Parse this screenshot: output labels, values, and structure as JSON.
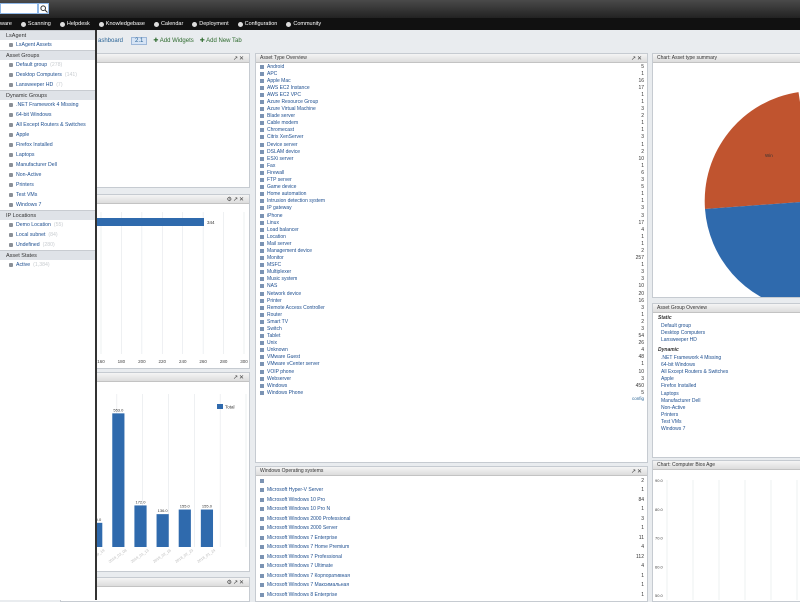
{
  "topbar": {
    "search_value": ""
  },
  "nav": {
    "items": [
      "ware",
      "Scanning",
      "Helpdesk",
      "Knowledgebase",
      "Calendar",
      "Deployment",
      "Configuration",
      "Community"
    ]
  },
  "tabbar": {
    "dashboard": "ashboard",
    "num": "2.1",
    "add_widgets": "Add Widgets",
    "add_tab": "Add New Tab"
  },
  "sidebar": {
    "sections": [
      {
        "title": "LsAgent",
        "items": [
          {
            "label": "LsAgent Assets",
            "count": ""
          }
        ]
      },
      {
        "title": "Asset Groups",
        "items": [
          {
            "label": "Default group",
            "count": "(278)"
          },
          {
            "label": "Desktop Computers",
            "count": "(141)"
          },
          {
            "label": "Lansweeper HD",
            "count": "(7)"
          }
        ]
      },
      {
        "title": "Dynamic Groups",
        "items": [
          {
            "label": ".NET Framework 4 Missing",
            "count": ""
          },
          {
            "label": "64-bit Windows",
            "count": ""
          },
          {
            "label": "All Except Routers & Switches",
            "count": ""
          },
          {
            "label": "Apple",
            "count": ""
          },
          {
            "label": "Firefox Installed",
            "count": ""
          },
          {
            "label": "Laptops",
            "count": ""
          },
          {
            "label": "Manufacturer Dell",
            "count": ""
          },
          {
            "label": "Non-Active",
            "count": ""
          },
          {
            "label": "Printers",
            "count": ""
          },
          {
            "label": "Test VMs",
            "count": ""
          },
          {
            "label": "Windows 7",
            "count": ""
          }
        ]
      },
      {
        "title": "IP Locations",
        "items": [
          {
            "label": "Demo Location",
            "count": "(55)"
          },
          {
            "label": "Local subnet",
            "count": "(84)"
          },
          {
            "label": "Undefined",
            "count": "(280)"
          }
        ]
      },
      {
        "title": "Asset States",
        "items": [
          {
            "label": "Active",
            "count": "(1,384)"
          }
        ]
      }
    ]
  },
  "asset_type_overview": {
    "title": "Asset Type Overview",
    "rows": [
      {
        "label": "Android",
        "value": "5"
      },
      {
        "label": "APC",
        "value": "1"
      },
      {
        "label": "Apple Mac",
        "value": "16"
      },
      {
        "label": "AWS EC2 Instance",
        "value": "17"
      },
      {
        "label": "AWS EC2 VPC",
        "value": "1"
      },
      {
        "label": "Azure Resource Group",
        "value": "1"
      },
      {
        "label": "Azure Virtual Machine",
        "value": "3"
      },
      {
        "label": "Blade server",
        "value": "2"
      },
      {
        "label": "Cable modem",
        "value": "1"
      },
      {
        "label": "Chromecast",
        "value": "1"
      },
      {
        "label": "Citrix XenServer",
        "value": "3"
      },
      {
        "label": "Device server",
        "value": "1"
      },
      {
        "label": "DSLAM device",
        "value": "2"
      },
      {
        "label": "ESXi server",
        "value": "10"
      },
      {
        "label": "Fax",
        "value": "1"
      },
      {
        "label": "Firewall",
        "value": "6"
      },
      {
        "label": "FTP server",
        "value": "3"
      },
      {
        "label": "Game device",
        "value": "5"
      },
      {
        "label": "Home automation",
        "value": "1"
      },
      {
        "label": "Intrusion detection system",
        "value": "1"
      },
      {
        "label": "IP gateway",
        "value": "3"
      },
      {
        "label": "iPhone",
        "value": "3"
      },
      {
        "label": "Linux",
        "value": "17"
      },
      {
        "label": "Load balancer",
        "value": "4"
      },
      {
        "label": "Location",
        "value": "1"
      },
      {
        "label": "Mail server",
        "value": "1"
      },
      {
        "label": "Management device",
        "value": "2"
      },
      {
        "label": "Monitor",
        "value": "257"
      },
      {
        "label": "MSFC",
        "value": "1"
      },
      {
        "label": "Multiplexer",
        "value": "3"
      },
      {
        "label": "Music system",
        "value": "3"
      },
      {
        "label": "NAS",
        "value": "10"
      },
      {
        "label": "Network device",
        "value": "20"
      },
      {
        "label": "Printer",
        "value": "16"
      },
      {
        "label": "Remote Access Controller",
        "value": "3"
      },
      {
        "label": "Router",
        "value": "1"
      },
      {
        "label": "Smart TV",
        "value": "2"
      },
      {
        "label": "Switch",
        "value": "3"
      },
      {
        "label": "Tablet",
        "value": "54"
      },
      {
        "label": "Unix",
        "value": "26"
      },
      {
        "label": "Unknown",
        "value": "4"
      },
      {
        "label": "VMware Guest",
        "value": "48"
      },
      {
        "label": "VMware vCenter server",
        "value": "1"
      },
      {
        "label": "VOIP phone",
        "value": "10"
      },
      {
        "label": "Webserver",
        "value": "3"
      },
      {
        "label": "Windows",
        "value": "450"
      },
      {
        "label": "Windows Phone",
        "value": "5"
      }
    ],
    "footer": "config"
  },
  "windows_os": {
    "title": "Windows Operating systems",
    "rows": [
      {
        "label": "",
        "value": "2"
      },
      {
        "label": "Microsoft Hyper-V Server",
        "value": "1"
      },
      {
        "label": "Microsoft Windows 10 Pro",
        "value": "84"
      },
      {
        "label": "Microsoft Windows 10 Pro N",
        "value": "1"
      },
      {
        "label": "Microsoft Windows 2000 Professional",
        "value": "3"
      },
      {
        "label": "Microsoft Windows 2000 Server",
        "value": "1"
      },
      {
        "label": "Microsoft Windows 7 Enterprise",
        "value": "11"
      },
      {
        "label": "Microsoft Windows 7 Home Premium",
        "value": "4"
      },
      {
        "label": "Microsoft Windows 7 Professional",
        "value": "112"
      },
      {
        "label": "Microsoft Windows 7 Ultimate",
        "value": "4"
      },
      {
        "label": "Microsoft Windows 7 Корпоративная",
        "value": "1"
      },
      {
        "label": "Microsoft Windows 7 Максимальная",
        "value": "1"
      },
      {
        "label": "Microsoft Windows 8 Enterprise",
        "value": "1"
      }
    ]
  },
  "asset_group_overview": {
    "title": "Asset Group Overview",
    "static_label": "Static",
    "static": [
      "Default group",
      "Desktop Computers",
      "Lansweeper HD"
    ],
    "dynamic_label": "Dynamic",
    "dynamic": [
      ".NET Framework 4 Missing",
      "64-bit Windows",
      "All Except Routers & Switches",
      "Apple",
      "Firefox Installed",
      "Laptops",
      "Manufacturer Dell",
      "Non-Active",
      "Printers",
      "Test VMs",
      "Windows 7"
    ]
  },
  "pie_panel": {
    "title": "Chart: Asset type summary",
    "slice_label": "Win"
  },
  "bios_panel": {
    "title": "Chart: Computer Bios Age"
  },
  "colors": {
    "pie_blue": "#2f6aad",
    "pie_red": "#c0542f",
    "bar_blue": "#2f6aad",
    "link": "#1d4e8f"
  },
  "chart_data": [
    {
      "type": "bar",
      "orientation": "horizontal",
      "values": [
        344
      ],
      "xlim": [
        0,
        300
      ],
      "tick_labels": [
        "160",
        "180",
        "200",
        "220",
        "240",
        "260",
        "280",
        "300"
      ],
      "data_labels": [
        "344"
      ]
    },
    {
      "type": "bar",
      "categories": [
        "2018_09_13",
        "2018_09_18",
        "2018_02_08",
        "2018_01_13",
        "2018_02_16",
        "2018_02_23",
        "2018_01_24"
      ],
      "series": [
        {
          "name": "Total",
          "values": [
            100.0,
            100.0,
            553.0,
            172.0,
            136.0,
            155.0,
            155.0
          ]
        }
      ],
      "data_labels": [
        "100.0",
        "100.0",
        "553.0",
        "172.0",
        "136.0",
        "155.0",
        "155.0"
      ],
      "legend": "top-right"
    },
    {
      "type": "pie",
      "slice_labels": [
        "Win"
      ],
      "colors": [
        "#2f6aad",
        "#c0542f"
      ]
    },
    {
      "type": "line",
      "yticks": [
        "90.0",
        "80.0",
        "70.0",
        "60.0",
        "50.0"
      ]
    }
  ]
}
